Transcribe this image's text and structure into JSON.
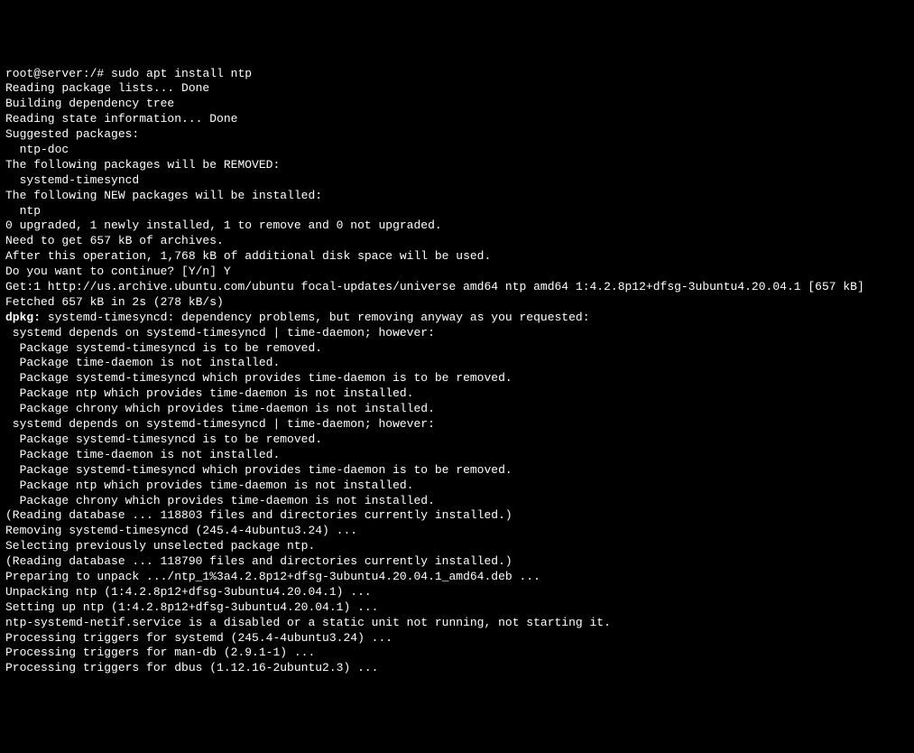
{
  "prompt": "root@server:/# ",
  "command": "sudo apt install ntp",
  "lines": [
    {
      "text": "Reading package lists... Done",
      "bold": false
    },
    {
      "text": "Building dependency tree",
      "bold": false
    },
    {
      "text": "Reading state information... Done",
      "bold": false
    },
    {
      "text": "Suggested packages:",
      "bold": false
    },
    {
      "text": "  ntp-doc",
      "bold": false
    },
    {
      "text": "The following packages will be REMOVED:",
      "bold": false
    },
    {
      "text": "  systemd-timesyncd",
      "bold": false
    },
    {
      "text": "The following NEW packages will be installed:",
      "bold": false
    },
    {
      "text": "  ntp",
      "bold": false
    },
    {
      "text": "0 upgraded, 1 newly installed, 1 to remove and 0 not upgraded.",
      "bold": false
    },
    {
      "text": "Need to get 657 kB of archives.",
      "bold": false
    },
    {
      "text": "After this operation, 1,768 kB of additional disk space will be used.",
      "bold": false
    },
    {
      "text": "Do you want to continue? [Y/n] Y",
      "bold": false
    },
    {
      "text": "Get:1 http://us.archive.ubuntu.com/ubuntu focal-updates/universe amd64 ntp amd64 1:4.2.8p12+dfsg-3ubuntu4.20.04.1 [657 kB]",
      "bold": false
    },
    {
      "text": "Fetched 657 kB in 2s (278 kB/s)",
      "bold": false
    }
  ],
  "dpkg_prefix": "dpkg:",
  "dpkg_line": " systemd-timesyncd: dependency problems, but removing anyway as you requested:",
  "dep_lines": [
    " systemd depends on systemd-timesyncd | time-daemon; however:",
    "  Package systemd-timesyncd is to be removed.",
    "  Package time-daemon is not installed.",
    "  Package systemd-timesyncd which provides time-daemon is to be removed.",
    "  Package ntp which provides time-daemon is not installed.",
    "  Package chrony which provides time-daemon is not installed.",
    " systemd depends on systemd-timesyncd | time-daemon; however:",
    "  Package systemd-timesyncd is to be removed.",
    "  Package time-daemon is not installed.",
    "  Package systemd-timesyncd which provides time-daemon is to be removed.",
    "  Package ntp which provides time-daemon is not installed.",
    "  Package chrony which provides time-daemon is not installed.",
    ""
  ],
  "post_lines": [
    "(Reading database ... 118803 files and directories currently installed.)",
    "Removing systemd-timesyncd (245.4-4ubuntu3.24) ...",
    "Selecting previously unselected package ntp.",
    "(Reading database ... 118790 files and directories currently installed.)",
    "Preparing to unpack .../ntp_1%3a4.2.8p12+dfsg-3ubuntu4.20.04.1_amd64.deb ...",
    "Unpacking ntp (1:4.2.8p12+dfsg-3ubuntu4.20.04.1) ...",
    "Setting up ntp (1:4.2.8p12+dfsg-3ubuntu4.20.04.1) ...",
    "ntp-systemd-netif.service is a disabled or a static unit not running, not starting it.",
    "Processing triggers for systemd (245.4-4ubuntu3.24) ...",
    "Processing triggers for man-db (2.9.1-1) ...",
    "Processing triggers for dbus (1.12.16-2ubuntu2.3) ..."
  ]
}
